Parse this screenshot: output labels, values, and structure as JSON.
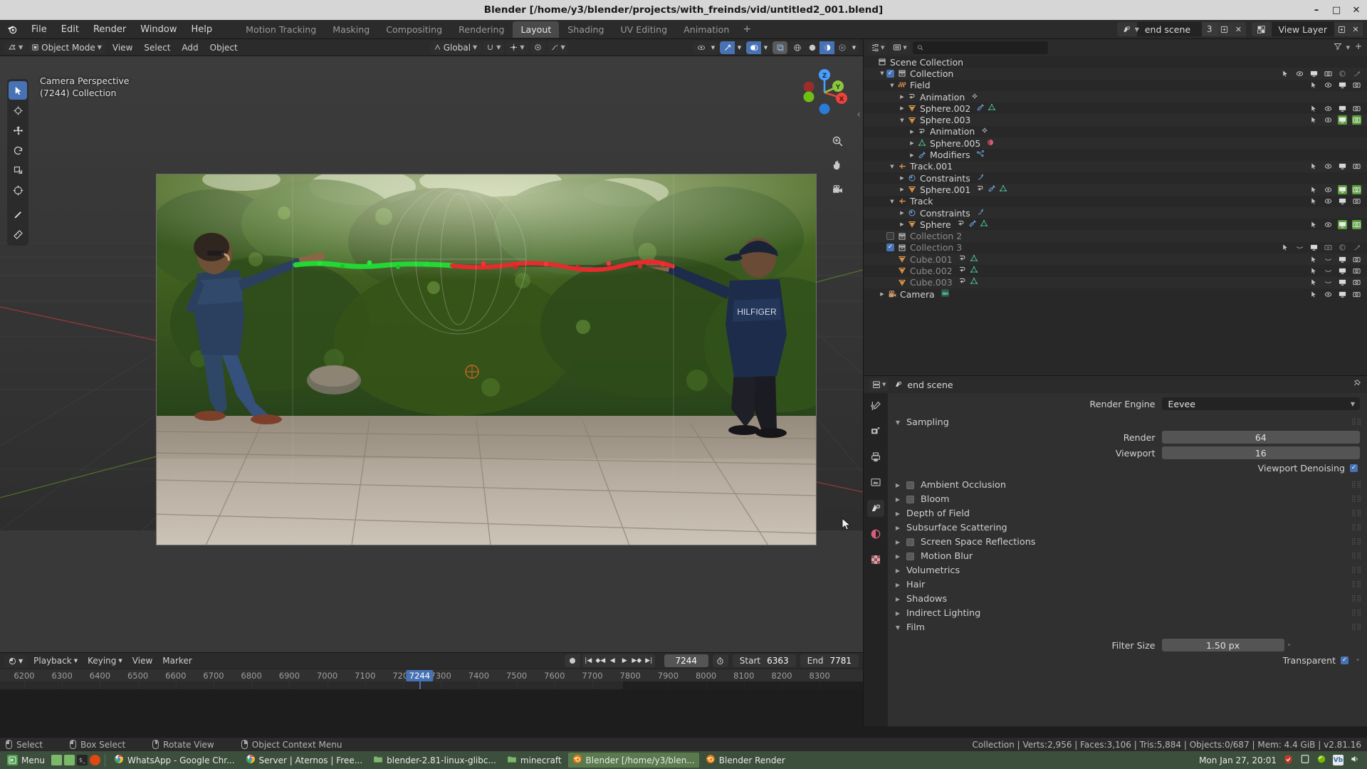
{
  "window": {
    "title": "Blender [/home/y3/blender/projects/with_freinds/vid/untitled2_001.blend]",
    "minimize": "–",
    "maximize": "□",
    "close": "✕"
  },
  "topbar": {
    "menus": [
      "File",
      "Edit",
      "Render",
      "Window",
      "Help"
    ],
    "workspaces": [
      {
        "label": "Motion Tracking",
        "active": false
      },
      {
        "label": "Masking",
        "active": false
      },
      {
        "label": "Compositing",
        "active": false
      },
      {
        "label": "Rendering",
        "active": false
      },
      {
        "label": "Layout",
        "active": true
      },
      {
        "label": "Shading",
        "active": false
      },
      {
        "label": "UV Editing",
        "active": false
      },
      {
        "label": "Animation",
        "active": false
      }
    ],
    "add_workspace": "+",
    "scene_name": "end scene",
    "scene_users": "3",
    "view_layer": "View Layer"
  },
  "viewport": {
    "mode": "Object Mode",
    "menus": [
      "View",
      "Select",
      "Add",
      "Object"
    ],
    "transform_orientation": "Global",
    "label_line1": "Camera Perspective",
    "label_line2": "(7244) Collection",
    "gizmo_axes": {
      "x": "X",
      "y": "Y",
      "z": "Z"
    },
    "tools": [
      "select-box-tool",
      "cursor-tool",
      "move-tool",
      "rotate-tool",
      "scale-tool",
      "transform-tool",
      "annotate-tool",
      "measure-tool"
    ]
  },
  "timeline": {
    "menus": [
      "Playback",
      "Keying",
      "View",
      "Marker"
    ],
    "current_frame": "7244",
    "start_label": "Start",
    "start_value": "6363",
    "end_label": "End",
    "end_value": "7781",
    "ticks": [
      "6200",
      "6300",
      "6400",
      "6500",
      "6600",
      "6700",
      "6800",
      "6900",
      "7000",
      "7100",
      "7200",
      "7300",
      "7400",
      "7500",
      "7600",
      "7700",
      "7800",
      "7900",
      "8000",
      "8100",
      "8200",
      "8300"
    ],
    "playhead_label": "7244"
  },
  "outliner": {
    "display_mode": "view-layer-icon",
    "filter_icon": "filter-icon",
    "search_placeholder": "",
    "rows": [
      {
        "indent": 0,
        "disclose": "",
        "icon": "scene-collection-icon",
        "name": "Scene Collection",
        "checkbox": null,
        "badges": [],
        "restrict": []
      },
      {
        "indent": 1,
        "disclose": "▼",
        "icon": "collection-icon",
        "name": "Collection",
        "checkbox": "on",
        "badges": [],
        "restrict": [
          "cursor",
          "eye",
          "screen",
          "camera",
          "holdout-off",
          "indirect-off"
        ]
      },
      {
        "indent": 2,
        "disclose": "▼",
        "icon": "force-field-icon",
        "name": "Field",
        "checkbox": null,
        "badges": [],
        "restrict": [
          "cursor",
          "eye",
          "screen",
          "camera"
        ]
      },
      {
        "indent": 3,
        "disclose": "▶",
        "icon": "animation-icon",
        "name": "Animation",
        "checkbox": null,
        "badges": [
          "action-icon"
        ],
        "restrict": []
      },
      {
        "indent": 3,
        "disclose": "▶",
        "icon": "mesh-object-icon",
        "name": "Sphere.002",
        "checkbox": null,
        "badges": [
          "modifier-icon",
          "mesh-data-icon"
        ],
        "restrict": [
          "cursor",
          "eye",
          "screen",
          "camera"
        ]
      },
      {
        "indent": 3,
        "disclose": "▼",
        "icon": "mesh-object-icon",
        "name": "Sphere.003",
        "checkbox": null,
        "badges": [],
        "restrict": [
          "cursor",
          "eye",
          "screen-green",
          "camera-green"
        ]
      },
      {
        "indent": 4,
        "disclose": "▶",
        "icon": "animation-icon",
        "name": "Animation",
        "checkbox": null,
        "badges": [
          "action-icon"
        ],
        "restrict": []
      },
      {
        "indent": 4,
        "disclose": "▶",
        "icon": "mesh-data-icon",
        "name": "Sphere.005",
        "checkbox": null,
        "badges": [
          "material-icon"
        ],
        "restrict": []
      },
      {
        "indent": 4,
        "disclose": "▶",
        "icon": "modifier-icon",
        "name": "Modifiers",
        "checkbox": null,
        "badges": [
          "node-icon"
        ],
        "restrict": []
      },
      {
        "indent": 2,
        "disclose": "▼",
        "icon": "empty-icon",
        "name": "Track.001",
        "checkbox": null,
        "badges": [],
        "restrict": [
          "cursor",
          "eye",
          "screen",
          "camera"
        ]
      },
      {
        "indent": 3,
        "disclose": "▶",
        "icon": "constraint-icon",
        "name": "Constraints",
        "checkbox": null,
        "badges": [
          "constraint-sub-icon"
        ],
        "restrict": []
      },
      {
        "indent": 3,
        "disclose": "▶",
        "icon": "mesh-object-icon",
        "name": "Sphere.001",
        "checkbox": null,
        "badges": [
          "animation-icon",
          "modifier-icon",
          "mesh-data-icon"
        ],
        "restrict": [
          "cursor",
          "eye",
          "screen-green",
          "camera-green"
        ]
      },
      {
        "indent": 2,
        "disclose": "▼",
        "icon": "empty-icon",
        "name": "Track",
        "checkbox": null,
        "badges": [],
        "restrict": [
          "cursor",
          "eye",
          "screen",
          "camera"
        ]
      },
      {
        "indent": 3,
        "disclose": "▶",
        "icon": "constraint-icon",
        "name": "Constraints",
        "checkbox": null,
        "badges": [
          "constraint-sub-icon"
        ],
        "restrict": []
      },
      {
        "indent": 3,
        "disclose": "▶",
        "icon": "mesh-object-icon",
        "name": "Sphere",
        "checkbox": null,
        "badges": [
          "animation-icon",
          "modifier-icon",
          "mesh-data-icon"
        ],
        "restrict": [
          "cursor",
          "eye",
          "screen-green",
          "camera-green"
        ]
      },
      {
        "indent": 1,
        "disclose": "",
        "icon": "collection-icon",
        "name": "Collection 2",
        "checkbox": "off",
        "badges": [],
        "restrict": [],
        "dim": true
      },
      {
        "indent": 1,
        "disclose": "",
        "icon": "collection-icon",
        "name": "Collection 3",
        "checkbox": "on",
        "badges": [],
        "restrict": [
          "cursor",
          "eye-closed",
          "screen",
          "camera-off",
          "holdout-off",
          "indirect-off"
        ],
        "dim": true
      },
      {
        "indent": 2,
        "disclose": "",
        "icon": "mesh-object-icon",
        "name": "Cube.001",
        "checkbox": null,
        "badges": [
          "animation-icon",
          "mesh-data-icon"
        ],
        "restrict": [
          "cursor",
          "eye-closed",
          "screen",
          "camera"
        ],
        "dim": true
      },
      {
        "indent": 2,
        "disclose": "",
        "icon": "mesh-object-icon",
        "name": "Cube.002",
        "checkbox": null,
        "badges": [
          "animation-icon",
          "mesh-data-icon"
        ],
        "restrict": [
          "cursor",
          "eye-closed",
          "screen",
          "camera"
        ],
        "dim": true
      },
      {
        "indent": 2,
        "disclose": "",
        "icon": "mesh-object-icon",
        "name": "Cube.003",
        "checkbox": null,
        "badges": [
          "animation-icon",
          "mesh-data-icon"
        ],
        "restrict": [
          "cursor",
          "eye-closed",
          "screen",
          "camera"
        ],
        "dim": true
      },
      {
        "indent": 1,
        "disclose": "▶",
        "icon": "camera-object-icon",
        "name": "Camera",
        "checkbox": null,
        "badges": [
          "camera-data-icon"
        ],
        "restrict": [
          "cursor",
          "eye",
          "screen",
          "camera"
        ]
      }
    ]
  },
  "properties": {
    "breadcrumb_scene": "end scene",
    "pin_icon": "pin-icon",
    "tabs": [
      "tool-tab",
      "render-tab",
      "output-tab",
      "view-layer-tab",
      "scene-tab",
      "world-tab",
      "texture-tab"
    ],
    "render_engine_label": "Render Engine",
    "render_engine_value": "Eevee",
    "sampling": {
      "title": "Sampling",
      "render_label": "Render",
      "render_value": "64",
      "viewport_label": "Viewport",
      "viewport_value": "16",
      "denoising_label": "Viewport Denoising",
      "denoising_checked": true
    },
    "panels": [
      {
        "title": "Ambient Occlusion",
        "checkbox": true,
        "checked": false
      },
      {
        "title": "Bloom",
        "checkbox": true,
        "checked": false
      },
      {
        "title": "Depth of Field",
        "checkbox": false
      },
      {
        "title": "Subsurface Scattering",
        "checkbox": false
      },
      {
        "title": "Screen Space Reflections",
        "checkbox": true,
        "checked": false
      },
      {
        "title": "Motion Blur",
        "checkbox": true,
        "checked": false
      },
      {
        "title": "Volumetrics",
        "checkbox": false
      },
      {
        "title": "Hair",
        "checkbox": false
      },
      {
        "title": "Shadows",
        "checkbox": false
      },
      {
        "title": "Indirect Lighting",
        "checkbox": false
      }
    ],
    "film": {
      "title": "Film",
      "filter_size_label": "Filter Size",
      "filter_size_value": "1.50 px",
      "transparent_label": "Transparent",
      "transparent_checked": true
    }
  },
  "statusbar": {
    "hints": [
      {
        "icon": "mouse-left-icon",
        "label": "Select"
      },
      {
        "icon": "mouse-left-drag-icon",
        "label": "Box Select"
      },
      {
        "icon": "mouse-middle-icon",
        "label": "Rotate View"
      },
      {
        "icon": "mouse-right-icon",
        "label": "Object Context Menu"
      }
    ],
    "stats": "Collection | Verts:2,956 | Faces:3,106 | Tris:5,884 | Objects:0/687 | Mem: 4.4 GiB | v2.81.16"
  },
  "taskbar": {
    "menu_label": "Menu",
    "launchers": [
      "files-icon",
      "files2-icon",
      "terminal-icon",
      "ubuntu-icon"
    ],
    "windows": [
      {
        "icon": "chrome-icon",
        "label": "WhatsApp - Google Chr...",
        "active": false
      },
      {
        "icon": "chrome-icon",
        "label": "Server | Aternos | Free...",
        "active": false
      },
      {
        "icon": "folder-icon",
        "label": "blender-2.81-linux-glibc...",
        "active": false
      },
      {
        "icon": "folder-icon",
        "label": "minecraft",
        "active": false
      },
      {
        "icon": "blender-icon",
        "label": "Blender [/home/y3/blen...",
        "active": true
      },
      {
        "icon": "blender-icon",
        "label": "Blender Render",
        "active": false
      }
    ],
    "clock": "Mon Jan 27, 20:01",
    "tray": [
      "shield-icon",
      "display-icon",
      "nvidia-icon",
      "vlc-icon",
      "volume-icon"
    ]
  },
  "colors": {
    "accent": "#4772b3",
    "green": "#5a9e3d",
    "orange": "#ed9e5c",
    "mesh_green": "#4ab58a",
    "taskbar": "#3c4f3c"
  }
}
